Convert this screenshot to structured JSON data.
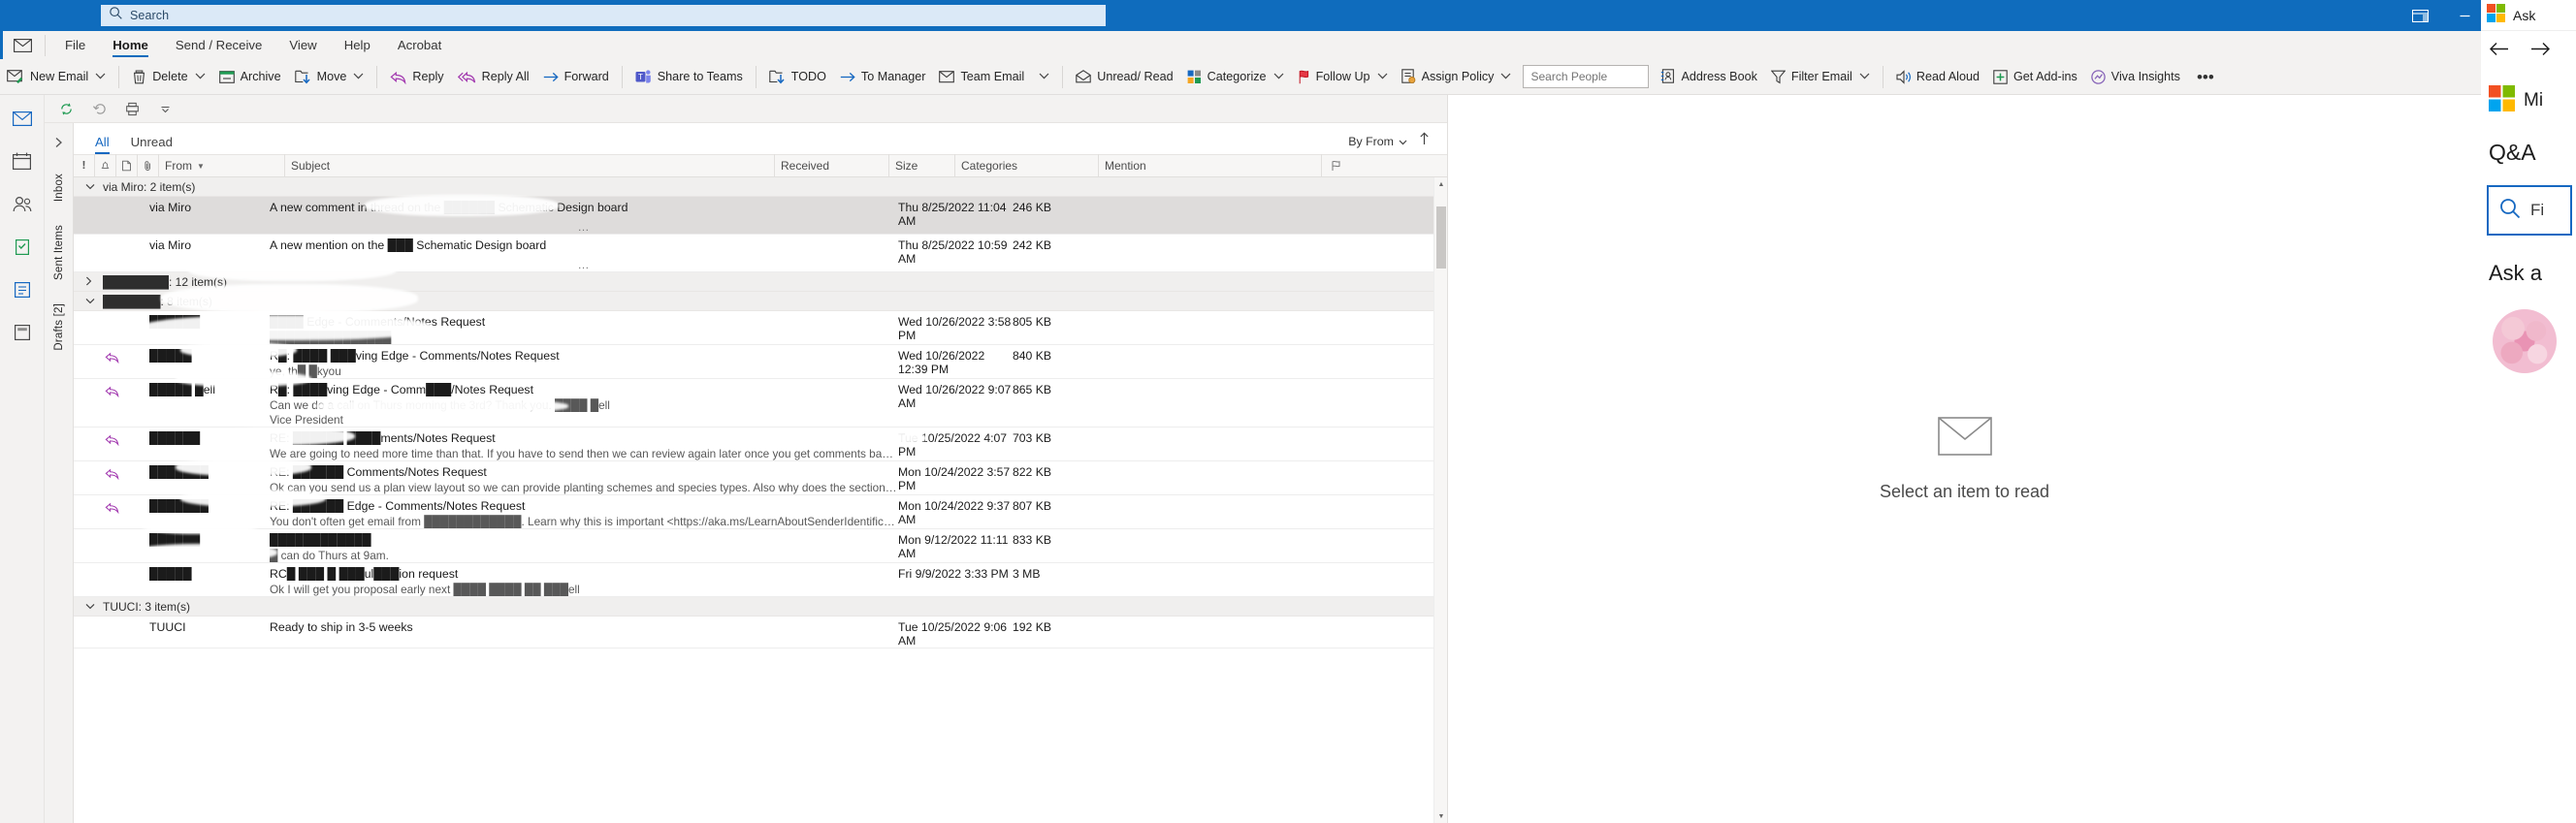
{
  "app": {
    "name": "Microsoft Outlook",
    "accent_color": "#0f6cbd",
    "titlebar_color": "#0f6cbd"
  },
  "titlebar": {
    "search_placeholder": "Search",
    "buttons": [
      {
        "name": "ribbon-display-options",
        "glyph": "ribbon"
      },
      {
        "name": "minimize",
        "glyph": "minimize"
      },
      {
        "name": "restore",
        "glyph": "restore"
      },
      {
        "name": "close",
        "glyph": "close"
      }
    ]
  },
  "menubar": {
    "items": [
      {
        "label": "File",
        "active": false
      },
      {
        "label": "Home",
        "active": true
      },
      {
        "label": "Send / Receive",
        "active": false
      },
      {
        "label": "View",
        "active": false
      },
      {
        "label": "Help",
        "active": false
      },
      {
        "label": "Acrobat",
        "active": false
      }
    ]
  },
  "ribbon": {
    "groups": [
      {
        "type": "button",
        "label": "New Email",
        "icon": "new-email-icon",
        "chevron": true
      },
      {
        "type": "divider"
      },
      {
        "type": "button",
        "label": "Delete",
        "icon": "delete-icon",
        "chevron": true
      },
      {
        "type": "button",
        "label": "Archive",
        "icon": "archive-icon",
        "chevron": false
      },
      {
        "type": "button",
        "label": "Move",
        "icon": "move-icon",
        "chevron": true
      },
      {
        "type": "divider"
      },
      {
        "type": "button",
        "label": "Reply",
        "icon": "reply-icon",
        "chevron": false
      },
      {
        "type": "button",
        "label": "Reply All",
        "icon": "reply-all-icon",
        "chevron": false
      },
      {
        "type": "button",
        "label": "Forward",
        "icon": "forward-icon",
        "chevron": false
      },
      {
        "type": "divider"
      },
      {
        "type": "button",
        "label": "Share to Teams",
        "icon": "teams-icon",
        "chevron": false
      },
      {
        "type": "divider"
      },
      {
        "type": "button",
        "label": "TODO",
        "icon": "todo-icon",
        "chevron": false
      },
      {
        "type": "button",
        "label": "To Manager",
        "icon": "to-manager-icon",
        "chevron": false
      },
      {
        "type": "button",
        "label": "Team Email",
        "icon": "team-email-icon",
        "chevron": false
      },
      {
        "type": "quickstep-more",
        "label": "",
        "icon": "chevron-down-icon",
        "chevron": true
      },
      {
        "type": "divider"
      },
      {
        "type": "button",
        "label": "Unread/ Read",
        "icon": "unread-read-icon",
        "chevron": false
      },
      {
        "type": "button",
        "label": "Categorize",
        "icon": "categorize-icon",
        "chevron": true
      },
      {
        "type": "button",
        "label": "Follow Up",
        "icon": "follow-up-icon",
        "chevron": true
      },
      {
        "type": "button",
        "label": "Assign Policy",
        "icon": "assign-policy-icon",
        "chevron": true
      },
      {
        "type": "searchfield",
        "placeholder": "Search People",
        "value": ""
      },
      {
        "type": "button",
        "label": "Address Book",
        "icon": "address-book-icon",
        "chevron": false
      },
      {
        "type": "button",
        "label": "Filter Email",
        "icon": "filter-email-icon",
        "chevron": true
      },
      {
        "type": "divider"
      },
      {
        "type": "button",
        "label": "Read Aloud",
        "icon": "read-aloud-icon",
        "chevron": false
      },
      {
        "type": "button",
        "label": "Get Add-ins",
        "icon": "get-addins-icon",
        "chevron": false
      },
      {
        "type": "button",
        "label": "Viva Insights",
        "icon": "viva-insights-icon",
        "chevron": false
      },
      {
        "type": "overflow",
        "label": "•••"
      }
    ]
  },
  "quick_access": {
    "buttons": [
      {
        "name": "send-receive-all-icon"
      },
      {
        "name": "undo-icon"
      },
      {
        "name": "print-icon"
      },
      {
        "name": "customize-quick-access-icon"
      }
    ]
  },
  "nav_rail": {
    "items": [
      {
        "name": "mail-icon",
        "selected": true
      },
      {
        "name": "calendar-icon",
        "selected": false
      },
      {
        "name": "people-icon",
        "selected": false
      },
      {
        "name": "tasks-icon",
        "selected": false
      },
      {
        "name": "todo-app-icon",
        "selected": false
      },
      {
        "name": "notes-icon",
        "selected": false
      }
    ]
  },
  "folder_pane": {
    "expand_label": "›",
    "folders": [
      {
        "label": "Inbox",
        "selected": false
      },
      {
        "label": "Sent Items",
        "selected": false
      },
      {
        "label": "Drafts [2]",
        "selected": false
      }
    ]
  },
  "message_list": {
    "tabs": [
      {
        "label": "All",
        "active": true
      },
      {
        "label": "Unread",
        "active": false
      }
    ],
    "sort_by_label": "By From",
    "sort_direction_icon": "arrow-up-icon",
    "columns": [
      {
        "label": "!",
        "key": "importance",
        "type": "icon"
      },
      {
        "label": "",
        "key": "reminder",
        "type": "icon"
      },
      {
        "label": "",
        "key": "item-type",
        "type": "icon"
      },
      {
        "label": "",
        "key": "attachment",
        "type": "icon"
      },
      {
        "label": "From",
        "key": "from",
        "sorted": true
      },
      {
        "label": "Subject",
        "key": "subject"
      },
      {
        "label": "Received",
        "key": "received"
      },
      {
        "label": "Size",
        "key": "size"
      },
      {
        "label": "Categories",
        "key": "categories"
      },
      {
        "label": "Mention",
        "key": "mention"
      },
      {
        "label": "",
        "key": "flag",
        "type": "icon"
      }
    ],
    "groups": [
      {
        "header": "via Miro: 2 item(s)",
        "expanded": true,
        "rows": [
          {
            "from": "via Miro",
            "subject": "A new comment in thread on the ██████ Schematic Design board",
            "preview": "",
            "received": "Thu 8/25/2022 11:04 AM",
            "size": "246 KB",
            "selected": true,
            "has_reply_icon": false,
            "dots": "…"
          },
          {
            "from": "via Miro",
            "subject": "A new mention on the ███ Schematic Design board",
            "preview": "",
            "received": "Thu 8/25/2022 10:59 AM",
            "size": "242 KB",
            "selected": false,
            "has_reply_icon": false,
            "dots": "…"
          }
        ]
      },
      {
        "header": "████████: 12 item(s)",
        "expanded": false,
        "rows": []
      },
      {
        "header": "███████: 8 item(s)",
        "expanded": true,
        "rows": [
          {
            "from": "██████",
            "subject": "████ Edge - Comments/Notes Request",
            "preview": "███████████████",
            "received": "Wed 10/26/2022 3:58 PM",
            "size": "805 KB",
            "selected": false,
            "has_reply_icon": false
          },
          {
            "from": "█████",
            "subject": "R█: ████ ███ving Edge - Comments/Notes Request",
            "preview": "ye, th█ █kyou",
            "received": "Wed 10/26/2022 12:39 PM",
            "size": "840 KB",
            "selected": false,
            "has_reply_icon": true
          },
          {
            "from": "█████ █ell",
            "subject": "R█: ████ving Edge - Comm███/Notes Request",
            "preview": "Can we do a call on Thurs morning the 3rd?  Thank you.     ████ █ell",
            "preview2": "Vice President",
            "received": "Wed 10/26/2022 9:07 AM",
            "size": "865 KB",
            "selected": false,
            "has_reply_icon": true
          },
          {
            "from": "██████",
            "subject": "RE: ██████ ████ments/Notes Request",
            "preview": "We are going to need more time than that.  If you have to send then we can review again later once you get comments back.  Sorry but this is a busy wee█ ███ ████ ██ ███ Friday.  Tha██",
            "received": "Tue 10/25/2022 4:07 PM",
            "size": "703 KB",
            "selected": false,
            "has_reply_icon": true
          },
          {
            "from": "███████",
            "subject": "RE: ██████ Comments/Notes Request",
            "preview": "Ok can you send us a plan view layout so we can provide planting schemes and species types.  Also why does the section show black mangroves?  Does Red not grow here as we discussed previously?  Please let me know.   Thanks,",
            "received": "Mon 10/24/2022 3:57 PM",
            "size": "822 KB",
            "selected": false,
            "has_reply_icon": true
          },
          {
            "from": "███████",
            "subject": "RE: ██████ Edge - Comments/Notes Request",
            "preview": "You don't often get email from ████████████. Learn why this is important <https://aka.ms/LearnAboutSenderIdentification>   Let us know if we need to jump on a call about the plants.   Thank█",
            "received": "Mon 10/24/2022 9:37 AM",
            "size": "807 KB",
            "selected": false,
            "has_reply_icon": true
          },
          {
            "from": "██████",
            "subject": "████████████",
            "preview": "█ can do Thurs at 9am.",
            "received": "Mon 9/12/2022 11:11 AM",
            "size": "833 KB",
            "selected": false,
            "has_reply_icon": false
          },
          {
            "from": "█████",
            "subject": "RC█ ███ █ ███ul███ion request",
            "preview": "Ok I will get you proposal early next ████  ████ ██ ███ell",
            "received": "Fri 9/9/2022 3:33 PM",
            "size": "3 MB",
            "selected": false,
            "has_reply_icon": false
          }
        ]
      },
      {
        "header": "TUUCI: 3 item(s)",
        "expanded": true,
        "rows": [
          {
            "from": "TUUCI",
            "subject": "Ready to ship in 3-5 weeks",
            "preview": "",
            "received": "Tue 10/25/2022 9:06 AM",
            "size": "192 KB",
            "selected": false,
            "has_reply_icon": false
          }
        ]
      }
    ]
  },
  "reading_pane": {
    "empty_message": "Select an item to read",
    "empty_icon": "envelope-icon"
  },
  "addin_panel": {
    "title": "Ask",
    "back_icon": "arrow-left-icon",
    "forward_icon": "arrow-right-icon",
    "brand_label": "Mi",
    "qa_label": "Q&A",
    "search_value": "Fi",
    "search_icon": "search-icon",
    "ask_label": "Ask a",
    "avatar_name": "user-avatar"
  }
}
